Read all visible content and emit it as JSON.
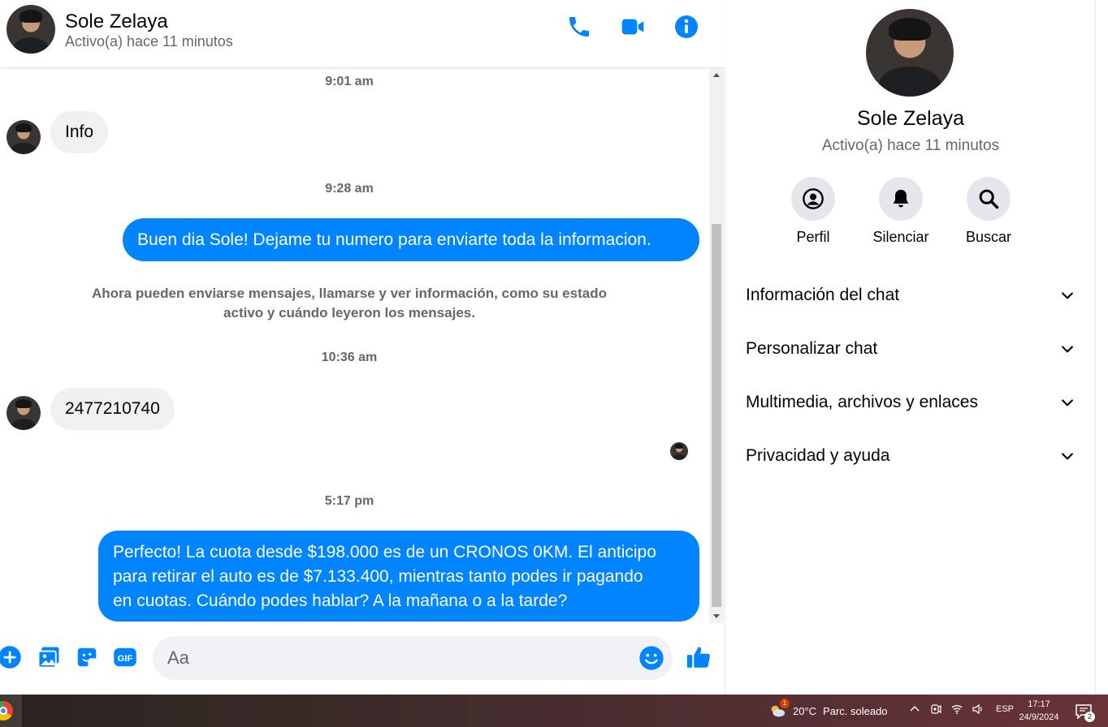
{
  "chat": {
    "contact_name": "Sole Zelaya",
    "contact_status": "Activo(a) hace 11 minutos",
    "messages": {
      "ts1": "9:01 am",
      "in1": "Info",
      "ts2": "9:28 am",
      "out1": "Buen dia Sole! Dejame tu numero para enviarte toda la informacion.",
      "system_line1": "Ahora pueden enviarse mensajes, llamarse y ver información, como su estado",
      "system_line2": "activo y cuándo leyeron los mensajes.",
      "ts3": "10:36 am",
      "in2": "2477210740",
      "ts4": "5:17 pm",
      "out2_line1": "Perfecto! La cuota desde $198.000 es de un CRONOS 0KM. El anticipo",
      "out2_line2": "para retirar el auto es de $7.133.400, mientras tanto podes ir pagando",
      "out2_line3": "en cuotas. Cuándo podes hablar? A la mañana o a la tarde?"
    },
    "composer": {
      "placeholder": "Aa"
    },
    "header_icons": [
      "phone-icon",
      "video-icon",
      "info-icon"
    ],
    "composer_icons": [
      "plus-icon",
      "image-icon",
      "sticker-icon",
      "gif-icon",
      "emoji-icon",
      "like-icon"
    ]
  },
  "panel": {
    "name": "Sole Zelaya",
    "status": "Activo(a) hace 11 minutos",
    "actions": {
      "profile": "Perfil",
      "mute": "Silenciar",
      "search": "Buscar"
    },
    "sections": {
      "chat_info": "Información del chat",
      "customize": "Personalizar chat",
      "media": "Multimedia, archivos y enlaces",
      "privacy": "Privacidad y ayuda"
    }
  },
  "taskbar": {
    "temperature": "20°C",
    "weather": "Parc. soleado",
    "weather_badge": "1",
    "language": "ESP",
    "time": "17:17",
    "date": "24/9/2024",
    "notifications": "2"
  },
  "colors": {
    "accent": "#0084ff",
    "incoming_bubble": "#f0f0f0",
    "secondary_text": "#65676b"
  }
}
